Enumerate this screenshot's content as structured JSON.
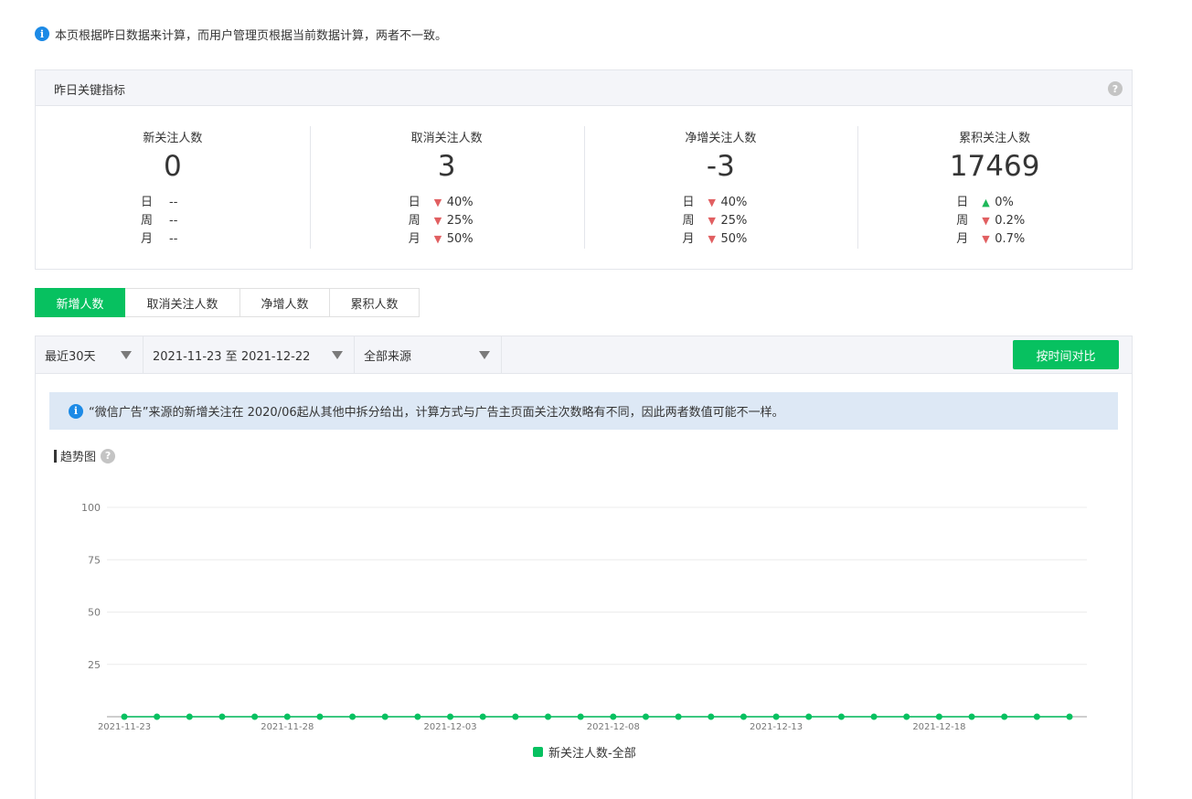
{
  "notice": {
    "icon": "info-icon",
    "text": "本页根据昨日数据来计算，而用户管理页根据当前数据计算，两者不一致。"
  },
  "kpi": {
    "title": "昨日关键指标",
    "help_icon": "question-icon",
    "cards": [
      {
        "label": "新关注人数",
        "value": "0",
        "rows": [
          {
            "k": "日",
            "dir": "none",
            "v": "--"
          },
          {
            "k": "周",
            "dir": "none",
            "v": "--"
          },
          {
            "k": "月",
            "dir": "none",
            "v": "--"
          }
        ]
      },
      {
        "label": "取消关注人数",
        "value": "3",
        "rows": [
          {
            "k": "日",
            "dir": "down",
            "v": "40%"
          },
          {
            "k": "周",
            "dir": "down",
            "v": "25%"
          },
          {
            "k": "月",
            "dir": "down",
            "v": "50%"
          }
        ]
      },
      {
        "label": "净增关注人数",
        "value": "-3",
        "rows": [
          {
            "k": "日",
            "dir": "down",
            "v": "40%"
          },
          {
            "k": "周",
            "dir": "down",
            "v": "25%"
          },
          {
            "k": "月",
            "dir": "down",
            "v": "50%"
          }
        ]
      },
      {
        "label": "累积关注人数",
        "value": "17469",
        "rows": [
          {
            "k": "日",
            "dir": "up",
            "v": "0%"
          },
          {
            "k": "周",
            "dir": "down",
            "v": "0.2%"
          },
          {
            "k": "月",
            "dir": "down",
            "v": "0.7%"
          }
        ]
      }
    ]
  },
  "tabs": [
    {
      "label": "新增人数",
      "active": true
    },
    {
      "label": "取消关注人数",
      "active": false
    },
    {
      "label": "净增人数",
      "active": false
    },
    {
      "label": "累积人数",
      "active": false
    }
  ],
  "filters": {
    "range": "最近30天",
    "dates": "2021-11-23 至 2021-12-22",
    "source": "全部来源",
    "compare_button": "按时间对比"
  },
  "tip": {
    "icon": "info-icon",
    "text": "“微信广告”来源的新增关注在 2020/06起从其他中拆分给出，计算方式与广告主页面关注次数略有不同，因此两者数值可能不一样。"
  },
  "trend": {
    "title": "趋势图",
    "help_icon": "question-icon"
  },
  "colors": {
    "accent": "#07c160",
    "up": "#1fb85a",
    "down": "#e15f61",
    "info": "#1c8ae6"
  },
  "chart_data": {
    "type": "line",
    "x": [
      "2021-11-23",
      "2021-11-24",
      "2021-11-25",
      "2021-11-26",
      "2021-11-27",
      "2021-11-28",
      "2021-11-29",
      "2021-11-30",
      "2021-12-01",
      "2021-12-02",
      "2021-12-03",
      "2021-12-04",
      "2021-12-05",
      "2021-12-06",
      "2021-12-07",
      "2021-12-08",
      "2021-12-09",
      "2021-12-10",
      "2021-12-11",
      "2021-12-12",
      "2021-12-13",
      "2021-12-14",
      "2021-12-15",
      "2021-12-16",
      "2021-12-17",
      "2021-12-18",
      "2021-12-19",
      "2021-12-20",
      "2021-12-21",
      "2021-12-22"
    ],
    "xticks": [
      "2021-11-23",
      "2021-11-28",
      "2021-12-03",
      "2021-12-08",
      "2021-12-13",
      "2021-12-18"
    ],
    "series": [
      {
        "name": "新关注人数-全部",
        "values": [
          0,
          0,
          0,
          0,
          0,
          0,
          0,
          0,
          0,
          0,
          0,
          0,
          0,
          0,
          0,
          0,
          0,
          0,
          0,
          0,
          0,
          0,
          0,
          0,
          0,
          0,
          0,
          0,
          0,
          0
        ]
      }
    ],
    "ylim": [
      0,
      100
    ],
    "yticks": [
      25,
      50,
      75,
      100
    ],
    "grid": true,
    "legend": "bottom"
  }
}
